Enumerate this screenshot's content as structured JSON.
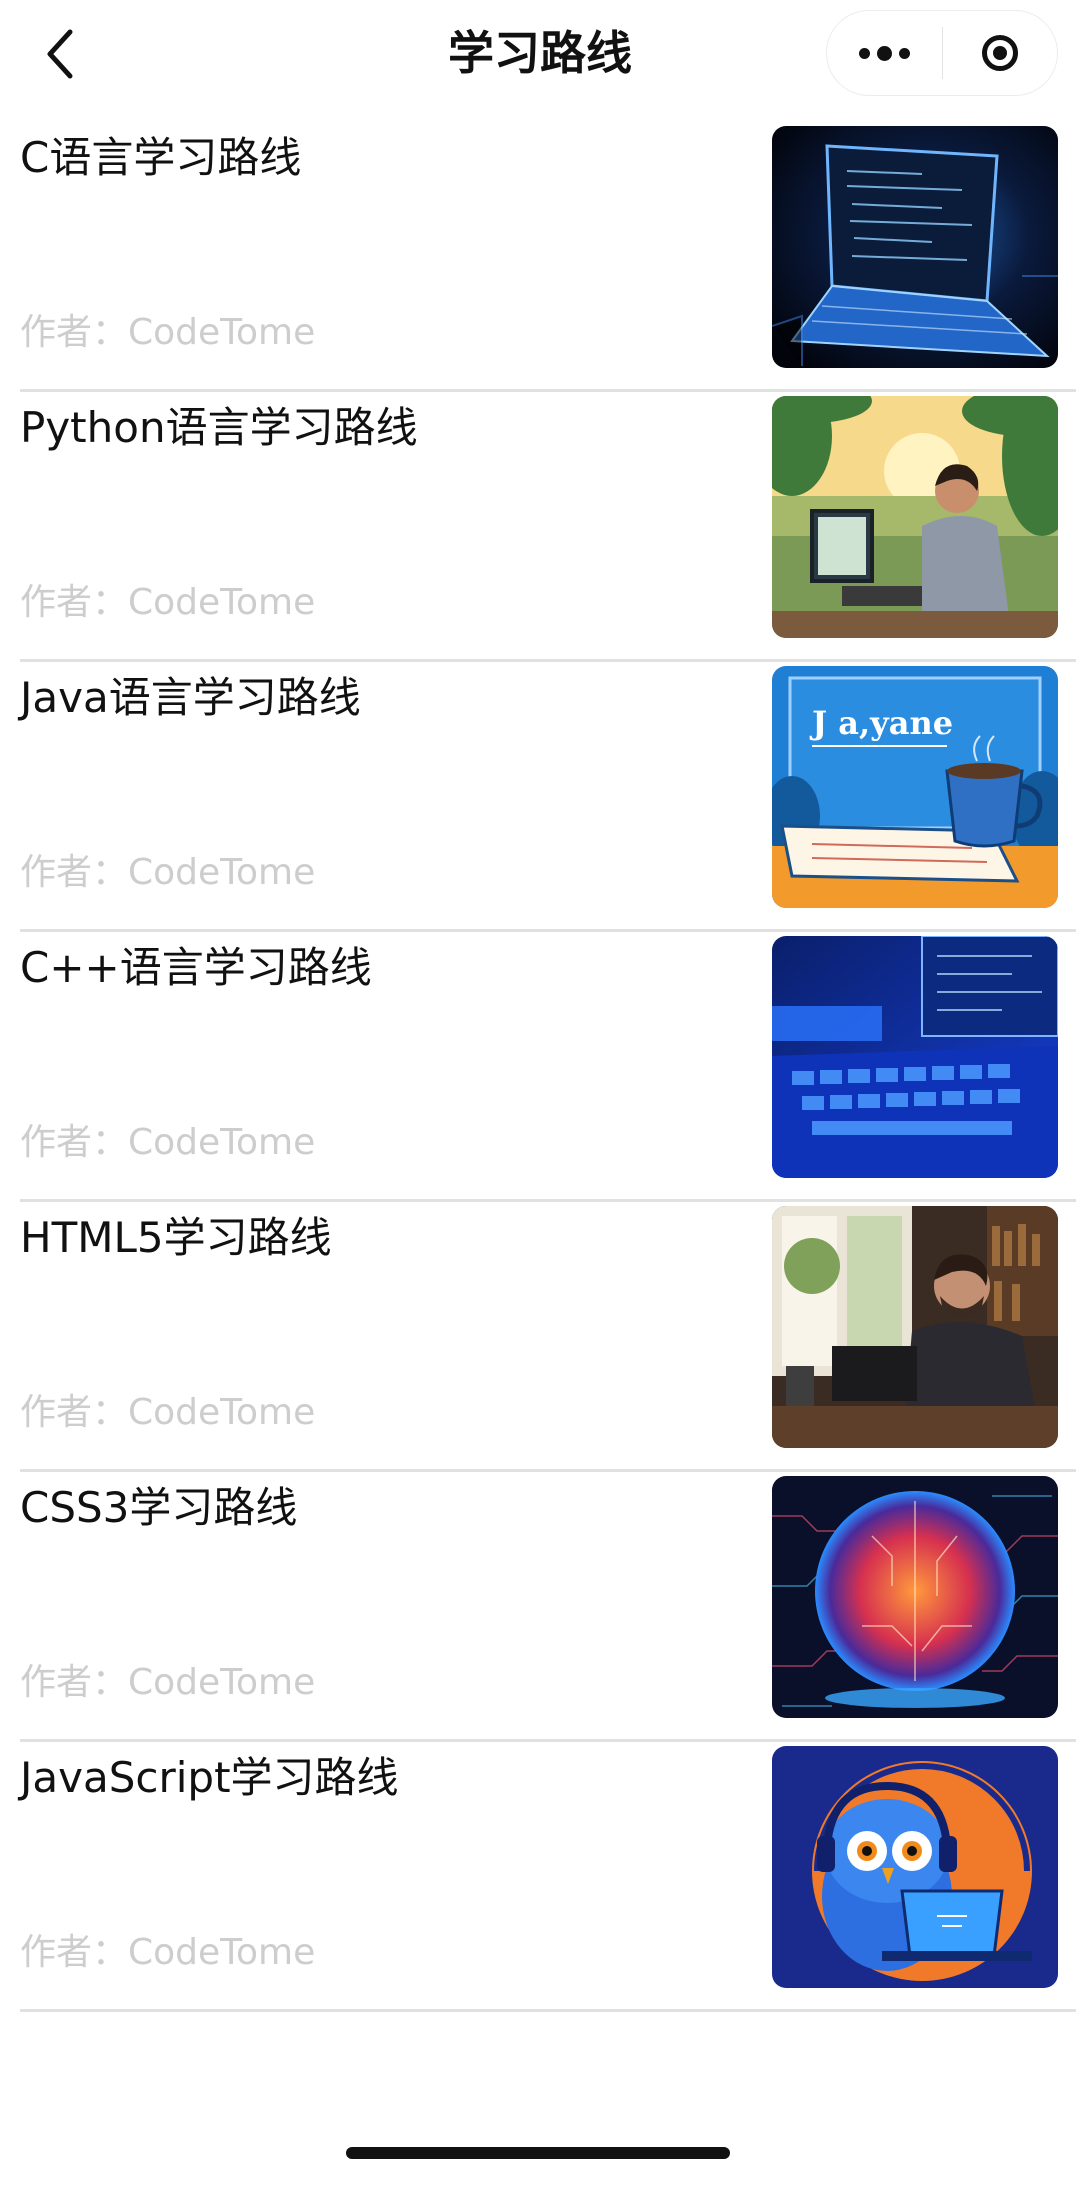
{
  "navbar": {
    "title": "学习路线",
    "back_icon": "chevron-left-icon",
    "more_icon": "more-dots-icon",
    "close_icon": "target-circle-icon"
  },
  "courses": [
    {
      "title": "C语言学习路线",
      "author": "作者：CodeTome",
      "thumbnail": "laptop-code-dark-blue"
    },
    {
      "title": "Python语言学习路线",
      "author": "作者：CodeTome",
      "thumbnail": "man-coding-jungle"
    },
    {
      "title": "Java语言学习路线",
      "author": "作者：CodeTome",
      "thumbnail": "coffee-cup-java-screen"
    },
    {
      "title": "C++语言学习路线",
      "author": "作者：CodeTome",
      "thumbnail": "keyboard-neon-blue"
    },
    {
      "title": "HTML5学习路线",
      "author": "作者：CodeTome",
      "thumbnail": "man-laptop-window"
    },
    {
      "title": "CSS3学习路线",
      "author": "作者：CodeTome",
      "thumbnail": "circuit-sphere-neon"
    },
    {
      "title": "JavaScript学习路线",
      "author": "作者：CodeTome",
      "thumbnail": "owl-headphones-laptop"
    }
  ],
  "thumb_screen_text": "J a,yane",
  "colors": {
    "title_text": "#111111",
    "author_text": "#cdcdcd",
    "divider": "#e1e1e1",
    "background": "#ffffff"
  }
}
